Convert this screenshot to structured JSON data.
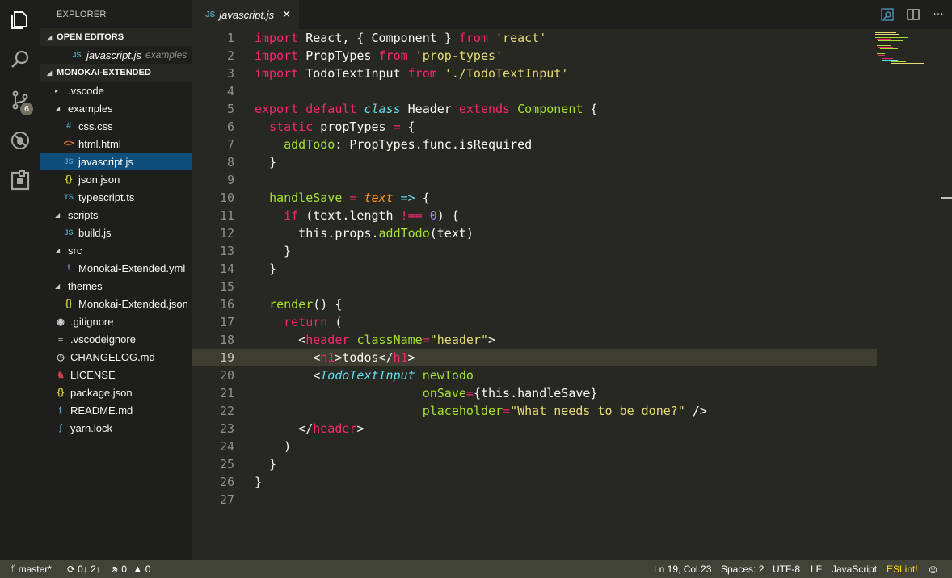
{
  "activity_bar": {
    "items": [
      {
        "name": "explorer-icon"
      },
      {
        "name": "search-icon"
      },
      {
        "name": "source-control-icon",
        "badge": "6"
      },
      {
        "name": "debug-icon"
      },
      {
        "name": "extensions-icon"
      }
    ]
  },
  "sidebar": {
    "title": "EXPLORER",
    "open_editors_label": "OPEN EDITORS",
    "open_editor": {
      "name": "javascript.js",
      "desc": "examples"
    },
    "project_label": "MONOKAI-EXTENDED",
    "tree": [
      {
        "label": ".vscode",
        "twist": "▸",
        "indent": 1
      },
      {
        "label": "examples",
        "twist": "◢",
        "indent": 1
      },
      {
        "label": "css.css",
        "icon": "#",
        "indent": 2
      },
      {
        "label": "html.html",
        "icon": "<>",
        "indent": 2
      },
      {
        "label": "javascript.js",
        "icon": "JS",
        "indent": 2,
        "selected": true
      },
      {
        "label": "json.json",
        "icon": "{}",
        "indent": 2
      },
      {
        "label": "typescript.ts",
        "icon": "TS",
        "indent": 2
      },
      {
        "label": "scripts",
        "twist": "◢",
        "indent": 1
      },
      {
        "label": "build.js",
        "icon": "JS",
        "indent": 2
      },
      {
        "label": "src",
        "twist": "◢",
        "indent": 1
      },
      {
        "label": "Monokai-Extended.yml",
        "icon": "!",
        "indent": 2
      },
      {
        "label": "themes",
        "twist": "◢",
        "indent": 1
      },
      {
        "label": "Monokai-Extended.json",
        "icon": "{}",
        "indent": 2
      },
      {
        "label": ".gitignore",
        "icon": "◉",
        "indent": 1
      },
      {
        "label": ".vscodeignore",
        "icon": "≡",
        "indent": 1
      },
      {
        "label": "CHANGELOG.md",
        "icon": "◷",
        "indent": 1
      },
      {
        "label": "LICENSE",
        "icon": "♞",
        "indent": 1
      },
      {
        "label": "package.json",
        "icon": "{}",
        "indent": 1
      },
      {
        "label": "README.md",
        "icon": "ℹ",
        "indent": 1
      },
      {
        "label": "yarn.lock",
        "icon": "ʃ",
        "indent": 1
      }
    ]
  },
  "tab": {
    "icon": "JS",
    "label": "javascript.js",
    "close": "✕"
  },
  "editor": {
    "current_line": 19,
    "lines": [
      "1",
      "2",
      "3",
      "4",
      "5",
      "6",
      "7",
      "8",
      "9",
      "10",
      "11",
      "12",
      "13",
      "14",
      "15",
      "16",
      "17",
      "18",
      "19",
      "20",
      "21",
      "22",
      "23",
      "24",
      "25",
      "26",
      "27"
    ]
  },
  "status_bar": {
    "branch": "master*",
    "sync": "0↓ 2↑",
    "errors": "0",
    "warnings": "0",
    "position": "Ln 19, Col 23",
    "spaces": "Spaces: 2",
    "encoding": "UTF-8",
    "eol": "LF",
    "language": "JavaScript",
    "eslint": "ESLint!"
  },
  "colors": {
    "background": "#272822",
    "sidebar": "#1e1f1c",
    "keyword": "#f92672",
    "string": "#e6db74",
    "function": "#a6e22e",
    "number": "#ae81ff",
    "type": "#66d9ef",
    "selection": "#0f4d7a"
  }
}
